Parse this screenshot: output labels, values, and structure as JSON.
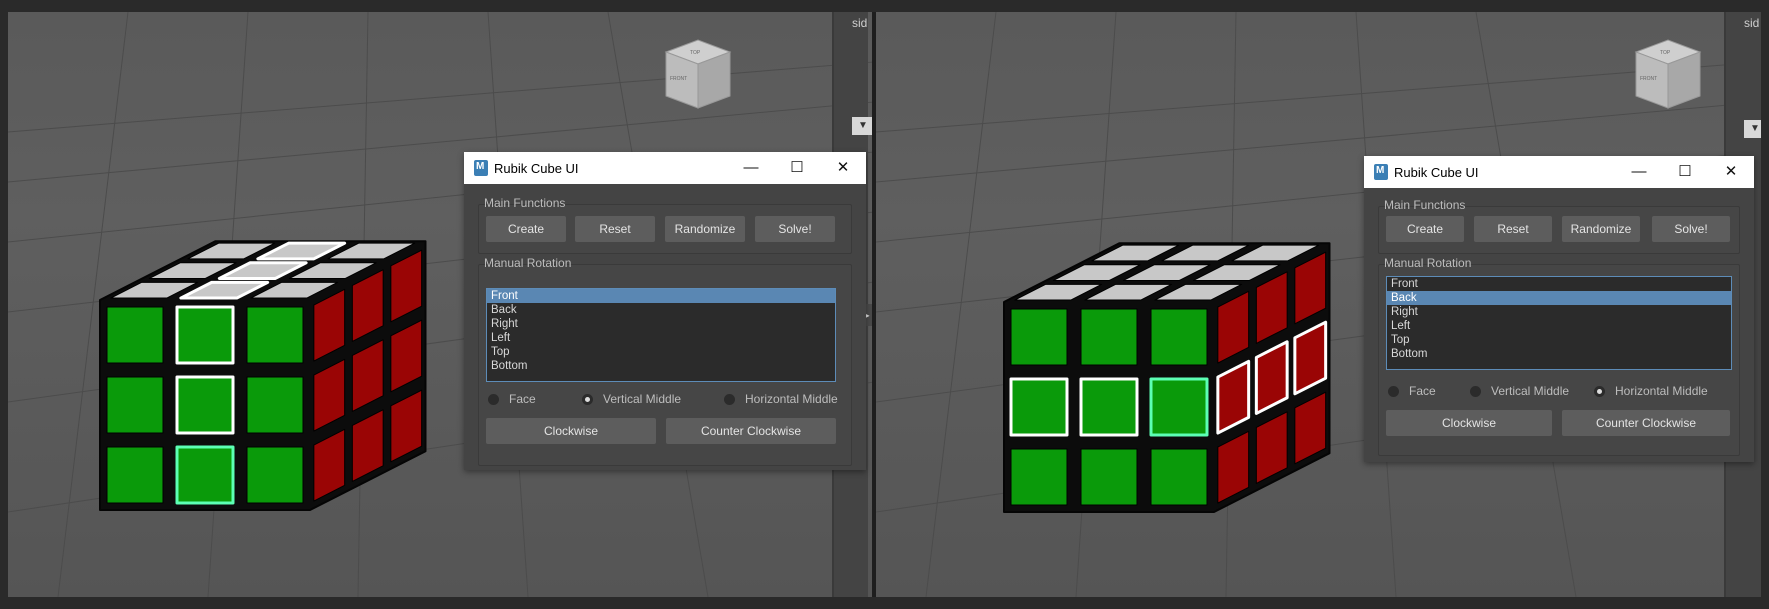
{
  "panes": [
    {
      "sidebar_text": "sid",
      "dialog": {
        "title": "Rubik Cube UI",
        "controls": {
          "minimize": "—",
          "maximize": "☐",
          "close": "✕"
        },
        "main_functions": {
          "label": "Main Functions",
          "buttons": [
            "Create",
            "Reset",
            "Randomize",
            "Solve!"
          ]
        },
        "manual_rotation": {
          "label": "Manual Rotation",
          "faces": [
            "Front",
            "Back",
            "Right",
            "Left",
            "Top",
            "Bottom"
          ],
          "selected_face": "Front",
          "modes": [
            "Face",
            "Vertical Middle",
            "Horizontal Middle"
          ],
          "selected_mode": "Vertical Middle",
          "buttons": [
            "Clockwise",
            "Counter Clockwise"
          ]
        }
      }
    },
    {
      "sidebar_text": "sid",
      "dialog": {
        "title": "Rubik Cube UI",
        "controls": {
          "minimize": "—",
          "maximize": "☐",
          "close": "✕"
        },
        "main_functions": {
          "label": "Main Functions",
          "buttons": [
            "Create",
            "Reset",
            "Randomize",
            "Solve!"
          ]
        },
        "manual_rotation": {
          "label": "Manual Rotation",
          "faces": [
            "Front",
            "Back",
            "Right",
            "Left",
            "Top",
            "Bottom"
          ],
          "selected_face": "Back",
          "modes": [
            "Face",
            "Vertical Middle",
            "Horizontal Middle"
          ],
          "selected_mode": "Horizontal Middle",
          "buttons": [
            "Clockwise",
            "Counter Clockwise"
          ]
        }
      }
    }
  ],
  "view_cube": {
    "top_label": "TOP",
    "front_label": "FRONT",
    "right_label": "RIGHT"
  },
  "colors": {
    "viewport_bg": "#5a5a5a",
    "cube_front": "#0a9a0a",
    "cube_right": "#9a0505",
    "cube_top": "#c8c8c8",
    "selection": "#ffffff",
    "selection_active": "#5cffb4",
    "list_selected": "#5a87b3"
  }
}
